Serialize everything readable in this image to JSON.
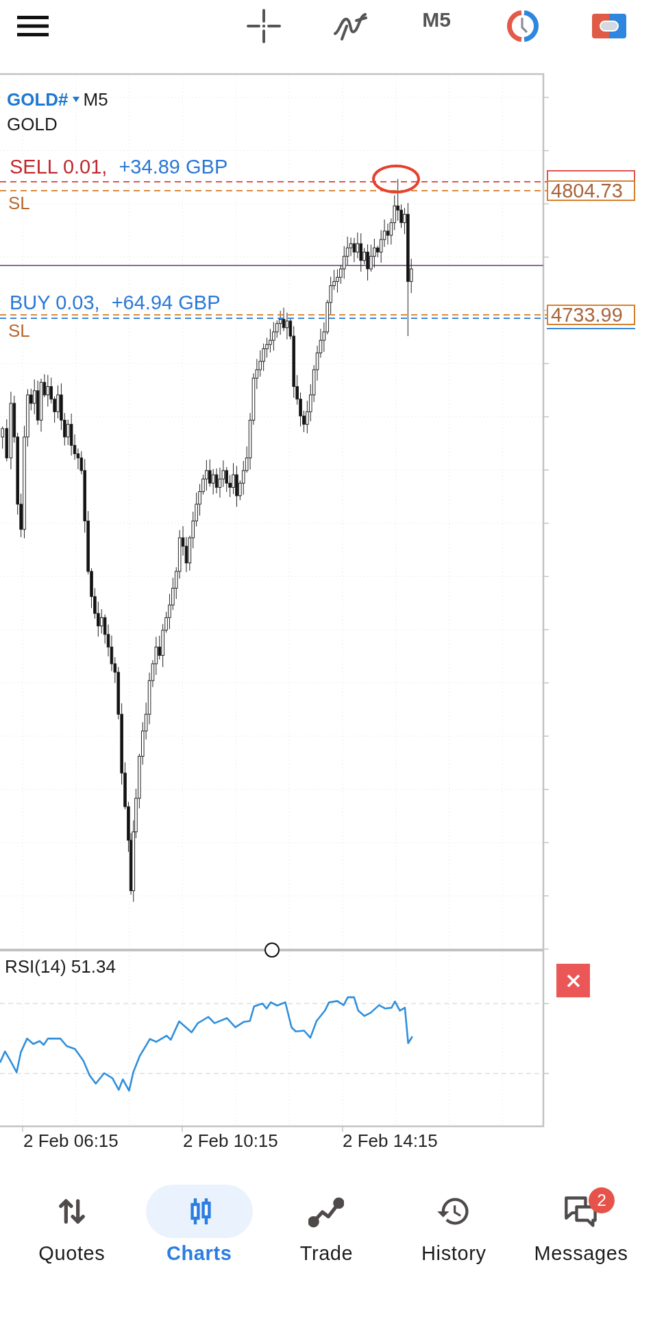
{
  "toolbar": {
    "timeframe": "M5"
  },
  "chart": {
    "symbol": "GOLD#",
    "timeframe": "M5",
    "description": "GOLD",
    "orders": [
      {
        "kind": "sell",
        "label": "SELL 0.01,",
        "profit": "+34.89 GBP",
        "stop_loss_label": "SL",
        "stop_loss_price": "4804.73"
      },
      {
        "kind": "buy",
        "label": "BUY 0.03,",
        "profit": "+64.94 GBP",
        "stop_loss_label": "SL",
        "stop_loss_price": "4733.99"
      }
    ]
  },
  "indicator": {
    "label": "RSI(14) 51.34"
  },
  "time_axis": {
    "labels": [
      "2 Feb 06:15",
      "2 Feb 10:15",
      "2 Feb 14:15"
    ]
  },
  "nav": [
    {
      "kind": "quotes",
      "label": "Quotes",
      "selected": false
    },
    {
      "kind": "charts",
      "label": "Charts",
      "selected": true
    },
    {
      "kind": "trade",
      "label": "Trade",
      "selected": false
    },
    {
      "kind": "history",
      "label": "History",
      "selected": false
    },
    {
      "kind": "messages",
      "label": "Messages",
      "selected": false,
      "badge": "2"
    }
  ]
}
